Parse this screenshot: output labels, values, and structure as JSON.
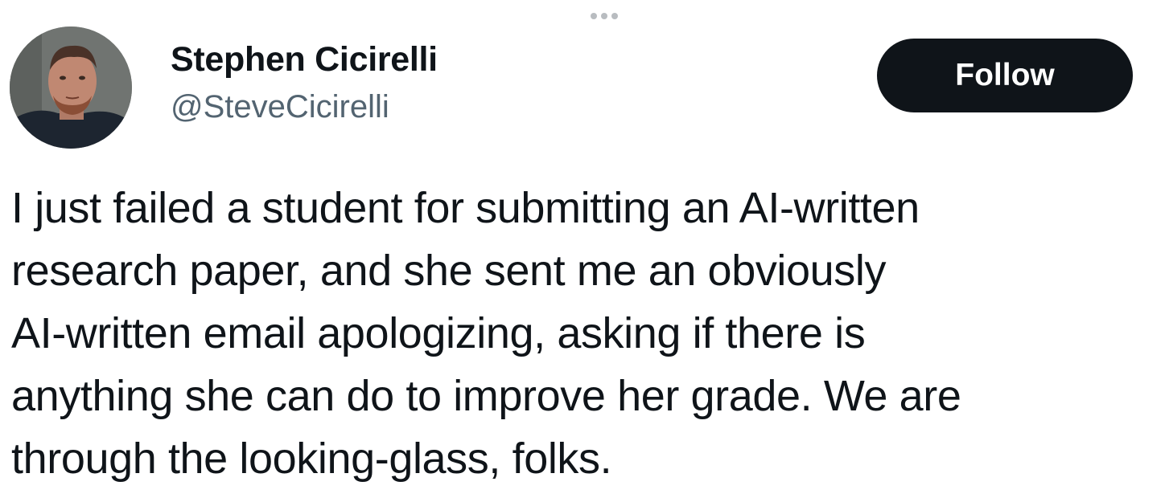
{
  "tweet": {
    "author": {
      "name": "Stephen Cicirelli",
      "handle": "@SteveCicirelli",
      "avatar_icon": "user-avatar-photo"
    },
    "follow_label": "Follow",
    "more_icon": "more-options-icon",
    "text_lines": [
      "I just failed a student for submitting an AI-written",
      "research paper, and she sent me an obviously",
      "AI-written email apologizing, asking if there is",
      "anything she can do to improve her grade. We are",
      "through the looking-glass, folks."
    ]
  },
  "colors": {
    "text_primary": "#0f1419",
    "text_secondary": "#536471",
    "button_bg": "#0f1419",
    "button_text": "#ffffff",
    "background": "#ffffff"
  }
}
